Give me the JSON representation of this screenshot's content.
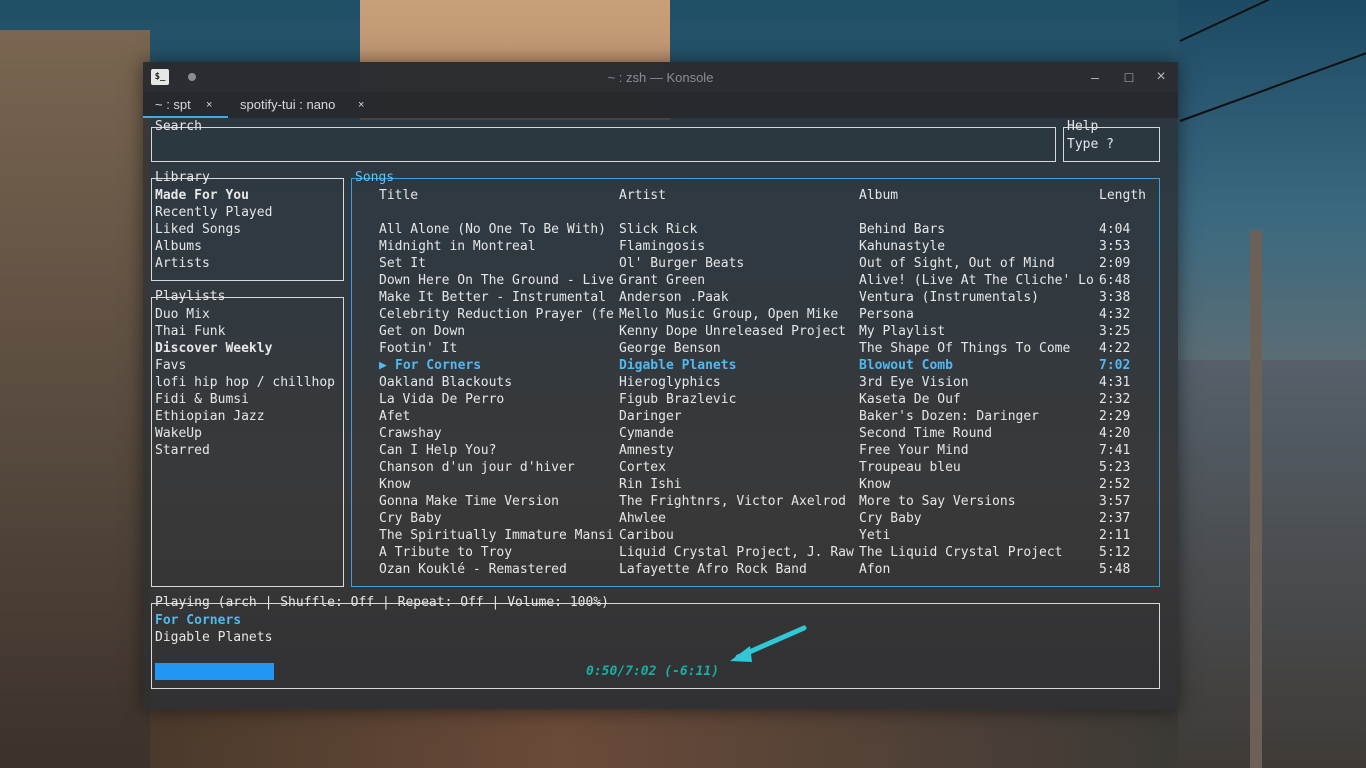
{
  "window": {
    "title": "~ : zsh — Konsole",
    "app_icon_glyph": "$_",
    "tabs": [
      {
        "label": "~ : spt",
        "close": "×",
        "active": true
      },
      {
        "label": "spotify-tui : nano",
        "close": "×",
        "active": false
      }
    ],
    "buttons": {
      "minimize": "–",
      "maximize": "□",
      "close": "×"
    }
  },
  "search": {
    "title": "Search",
    "value": ""
  },
  "help": {
    "title": "Help",
    "text": "Type ?"
  },
  "library": {
    "title": "Library",
    "items": [
      "Made For You",
      "Recently Played",
      "Liked Songs",
      "Albums",
      "Artists"
    ],
    "selected": "Made For You"
  },
  "playlists": {
    "title": "Playlists",
    "items": [
      "Duo Mix",
      "Thai Funk",
      "Discover Weekly",
      "Favs",
      "lofi hip hop / chillhop",
      "Fidi & Bumsi",
      "Ethiopian Jazz",
      "WakeUp",
      "Starred"
    ],
    "selected": "Discover Weekly"
  },
  "songs": {
    "title": "Songs",
    "headers": {
      "title": "Title",
      "artist": "Artist",
      "album": "Album",
      "length": "Length"
    },
    "playing_marker": "▶",
    "rows": [
      {
        "title": "All Alone (No One To Be With)",
        "artist": "Slick Rick",
        "album": "Behind Bars",
        "length": "4:04"
      },
      {
        "title": "Midnight in Montreal",
        "artist": "Flamingosis",
        "album": "Kahunastyle",
        "length": "3:53"
      },
      {
        "title": "Set It",
        "artist": "Ol' Burger Beats",
        "album": "Out of Sight, Out of Mind",
        "length": "2:09"
      },
      {
        "title": "Down Here On The Ground - Live",
        "artist": "Grant Green",
        "album": "Alive! (Live At The Cliche' Lounge)",
        "length": "6:48"
      },
      {
        "title": "Make It Better - Instrumental",
        "artist": "Anderson .Paak",
        "album": "Ventura (Instrumentals)",
        "length": "3:38"
      },
      {
        "title": "Celebrity Reduction Prayer (feat",
        "artist": "Mello Music Group, Open Mike",
        "album": "Persona",
        "length": "4:32"
      },
      {
        "title": "Get on Down",
        "artist": "Kenny Dope Unreleased Project",
        "album": "My Playlist",
        "length": "3:25"
      },
      {
        "title": "Footin' It",
        "artist": "George Benson",
        "album": "The Shape Of Things To Come",
        "length": "4:22"
      },
      {
        "title": "For Corners",
        "artist": "Digable Planets",
        "album": "Blowout Comb",
        "length": "7:02",
        "playing": true
      },
      {
        "title": "Oakland Blackouts",
        "artist": "Hieroglyphics",
        "album": "3rd Eye Vision",
        "length": "4:31"
      },
      {
        "title": "La Vida De Perro",
        "artist": "Figub Brazlevic",
        "album": "Kaseta De Ouf",
        "length": "2:32"
      },
      {
        "title": "Afet",
        "artist": "Daringer",
        "album": "Baker's Dozen: Daringer",
        "length": "2:29"
      },
      {
        "title": "Crawshay",
        "artist": "Cymande",
        "album": "Second Time Round",
        "length": "4:20"
      },
      {
        "title": "Can I Help You?",
        "artist": "Amnesty",
        "album": "Free Your Mind",
        "length": "7:41"
      },
      {
        "title": "Chanson d'un jour d'hiver",
        "artist": "Cortex",
        "album": "Troupeau bleu",
        "length": "5:23"
      },
      {
        "title": "Know",
        "artist": "Rin Ishi",
        "album": "Know",
        "length": "2:52"
      },
      {
        "title": "Gonna Make Time Version",
        "artist": "The Frightnrs, Victor Axelrod",
        "album": "More to Say Versions",
        "length": "3:57"
      },
      {
        "title": "Cry Baby",
        "artist": "Ahwlee",
        "album": "Cry Baby",
        "length": "2:37"
      },
      {
        "title": "The Spiritually Immature Mansion",
        "artist": "Caribou",
        "album": "Yeti",
        "length": "2:11"
      },
      {
        "title": "A Tribute to Troy",
        "artist": "Liquid Crystal Project, J. Rawls",
        "album": "The Liquid Crystal Project",
        "length": "5:12"
      },
      {
        "title": "Ozan Kouklé - Remastered",
        "artist": "Lafayette Afro Rock Band",
        "album": "Afon",
        "length": "5:48"
      }
    ]
  },
  "player": {
    "title": "Playing (arch | Shuffle: Off | Repeat: Off  | Volume: 100%)",
    "track": "For Corners",
    "artist": "Digable Planets",
    "time_text": "0:50/7:02 (-6:11)",
    "progress": 0.119
  },
  "colors": {
    "accent": "#4fb9f0",
    "songs_border": "#3da0d8",
    "progress": "#2196f3",
    "time": "#1aaea2",
    "annotation_arrow": "#2ec8d6"
  },
  "annotation": {
    "icon": "arrow-annotation-icon"
  }
}
